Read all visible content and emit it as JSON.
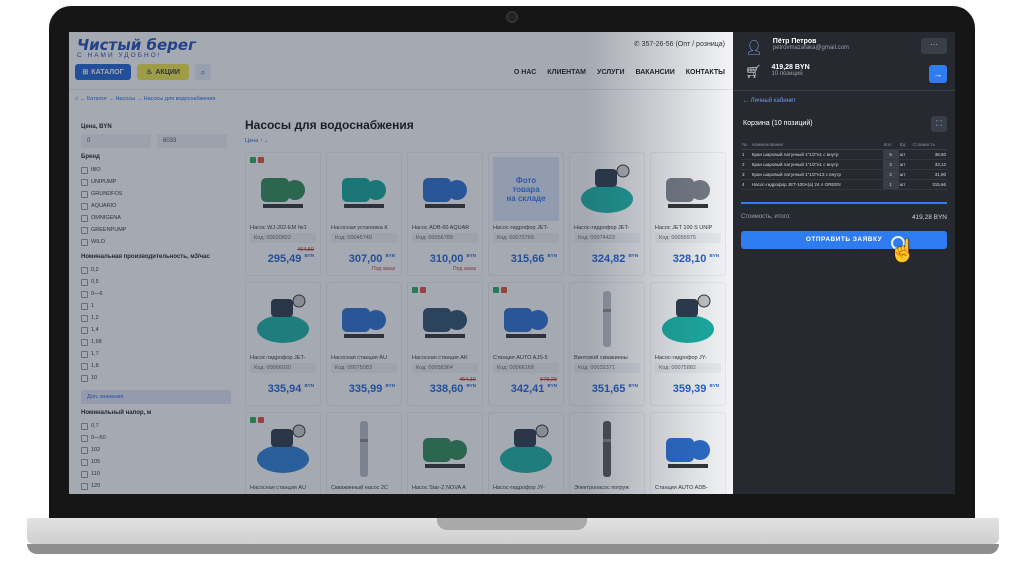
{
  "header": {
    "logo": "Чистый берег",
    "slogan": "С НАМИ УДОБНО!",
    "phone": "357-26-56 (Опт / розница)",
    "catalog": "КАТАЛОГ",
    "promo": "АКЦИИ",
    "nav": [
      "О НАС",
      "КЛИЕНТАМ",
      "УСЛУГИ",
      "ВАКАНСИИ",
      "КОНТАКТЫ"
    ]
  },
  "breadcrumbs": "→ Каталог → Насосы → Насосы для водоснабжения",
  "filters": {
    "price_title": "Цена, BYN",
    "price_from": "0",
    "price_to": "6033",
    "brand_title": "Бренд",
    "brands": [
      "IBO",
      "UNIPUMP",
      "GRUNDFOS",
      "AQUARIO",
      "OMNIGENA",
      "GREENPUMP",
      "WILO"
    ],
    "capacity_title": "Номинальная производительность, м3/час",
    "capacities": [
      "0,2",
      "0,5",
      "0—6",
      "1",
      "1,2",
      "1,4",
      "1,68",
      "1,7",
      "1,8",
      "10"
    ],
    "more": "Доп. значения",
    "head_title": "Номинальный напор, м",
    "heads": [
      "0,7",
      "0—50",
      "102",
      "105",
      "110",
      "120"
    ]
  },
  "main": {
    "title": "Насосы для водоснабжения",
    "sort": "Цена ↑"
  },
  "products": [
    {
      "name": "Насос WJ-202-EM №1",
      "code": "Код: 00020822",
      "old": "464,59",
      "price": "295,49",
      "order": "",
      "img": "pump-green",
      "tags": true
    },
    {
      "name": "Насосная установка К",
      "code": "Код: 00045740",
      "old": "",
      "price": "307,00",
      "order": "Под заказ",
      "img": "pump-teal",
      "tags": false
    },
    {
      "name": "Насос ADB-60 AQUAR",
      "code": "Код: 00056789",
      "old": "",
      "price": "310,00",
      "order": "Под заказ",
      "img": "pump-blue",
      "tags": false
    },
    {
      "name": "Насос-гидрофор JET-",
      "code": "Код: 00073768",
      "old": "",
      "price": "315,66",
      "order": "",
      "img": "photo",
      "tags": false
    },
    {
      "name": "Насос-гидрофор JET-",
      "code": "Код: 00074423",
      "old": "",
      "price": "324,82",
      "order": "",
      "img": "tank-teal",
      "tags": false
    },
    {
      "name": "Насос JET 100 S UNIP",
      "code": "Код: 00056975",
      "old": "",
      "price": "328,10",
      "order": "",
      "img": "pump-gray",
      "tags": false
    },
    {
      "name": "Насос-гидрофор JET-",
      "code": "Код: 00066030",
      "old": "",
      "price": "335,94",
      "order": "",
      "img": "tank-teal",
      "tags": false
    },
    {
      "name": "Насосная станция AU",
      "code": "Код: 00075083",
      "old": "",
      "price": "335,99",
      "order": "",
      "img": "pump-blue",
      "tags": false
    },
    {
      "name": "Насосная станция AK",
      "code": "Код: 00058364",
      "old": "454,10",
      "price": "338,60",
      "order": "",
      "img": "pump-dark",
      "tags": true
    },
    {
      "name": "Станция AUTO AJS-5",
      "code": "Код: 00066168",
      "old": "578,29",
      "price": "342,41",
      "order": "",
      "img": "pump-blue",
      "tags": true
    },
    {
      "name": "Винтовой скважинны",
      "code": "Код: 00032371",
      "old": "",
      "price": "351,65",
      "order": "",
      "img": "bore",
      "tags": false
    },
    {
      "name": "Насос-гидрофор JY-",
      "code": "Код: 00075882",
      "old": "",
      "price": "359,39",
      "order": "",
      "img": "tank-teal",
      "tags": false
    },
    {
      "name": "Насосная станция AU",
      "code": "",
      "old": "",
      "price": "",
      "order": "",
      "img": "tank-blue",
      "tags": true
    },
    {
      "name": "Скважинный насос 2С",
      "code": "",
      "old": "",
      "price": "",
      "order": "",
      "img": "bore",
      "tags": false
    },
    {
      "name": "Насос Star-Z NOVA A",
      "code": "",
      "old": "",
      "price": "",
      "order": "",
      "img": "pump-green",
      "tags": false
    },
    {
      "name": "Насос-гидрофор JY-",
      "code": "",
      "old": "",
      "price": "",
      "order": "",
      "img": "tank-teal",
      "tags": false
    },
    {
      "name": "Электронасос погруж",
      "code": "",
      "old": "",
      "price": "",
      "order": "",
      "img": "bore-dark",
      "tags": false
    },
    {
      "name": "Станция AUTO ADB-",
      "code": "",
      "old": "",
      "price": "",
      "order": "",
      "img": "pump-blue",
      "tags": false
    }
  ],
  "currency": "BYN",
  "photo_placeholder": [
    "Фото",
    "товара",
    "на складе"
  ],
  "sidebar": {
    "user_name": "Пётр Петров",
    "user_email": "petrovmazafaka@gmail.com",
    "cart_total": "419,28 BYN",
    "cart_count": "10 позиций",
    "account_link": "← Личный кабинет",
    "cart_title": "Корзина (10 позиций)",
    "table_headers": [
      "№",
      "Наименование",
      "Кол.",
      "Ед.",
      "Стоимость"
    ],
    "rows": [
      {
        "n": "1",
        "name": "Кран шаровый латунный 1\"1/2\"н1 с внутр",
        "qty": "5",
        "unit": "шт",
        "cost": "38,60"
      },
      {
        "n": "2",
        "name": "Кран шаровый латунный 1\"1/2\"н1 с внутр",
        "qty": "2",
        "unit": "шт",
        "cost": "33,12"
      },
      {
        "n": "3",
        "name": "Кран шаровый латунный 1\"1/2\"н13 с внутр",
        "qty": "2",
        "unit": "шт",
        "cost": "31,90"
      },
      {
        "n": "4",
        "name": "Насос-гидрофор JET-100А(a) 24 л GREEN",
        "qty": "1",
        "unit": "шт",
        "cost": "315,66"
      }
    ],
    "total_label": "Стоимость, итого:",
    "total_value": "419,28 BYN",
    "submit": "ОТПРАВИТЬ ЗАЯВКУ"
  },
  "colors": {
    "accent": "#1e63d6",
    "sidebar_bg": "#26292f",
    "button": "#2f7bf0",
    "promo": "#f5e84a"
  }
}
